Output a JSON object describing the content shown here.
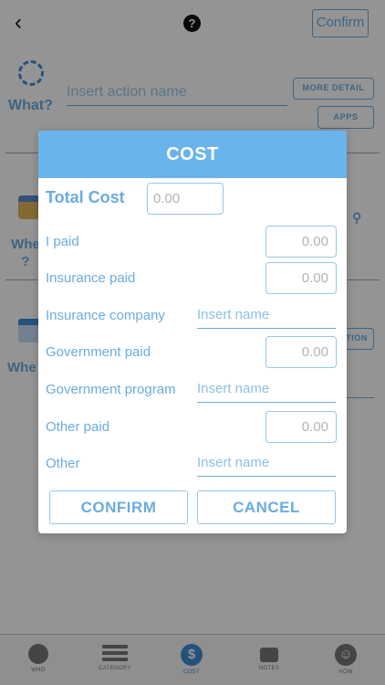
{
  "header": {
    "back_glyph": "‹",
    "help_glyph": "?",
    "confirm_label": "Confirm"
  },
  "what": {
    "label": "What?",
    "action_placeholder": "Insert action name",
    "more_detail_label": "MORE DETAIL",
    "apps_label": "APPS"
  },
  "when": {
    "label_line1": "Whe",
    "label_line2": "?"
  },
  "where": {
    "label": "Whe",
    "location_btn_fragment": "TION"
  },
  "tabbar": {
    "tabs": [
      {
        "label": "WHO",
        "icon": "person-icon"
      },
      {
        "label": "CATEGORY",
        "icon": "list-icon"
      },
      {
        "label": "COST",
        "icon": "dollar-icon",
        "selected": true
      },
      {
        "label": "NOTES",
        "icon": "notes-icon"
      },
      {
        "label": "HOW",
        "icon": "smile-icon"
      }
    ]
  },
  "cost_modal": {
    "title": "COST",
    "total_cost_label": "Total Cost",
    "total_cost_placeholder": "0.00",
    "i_paid_label": "I paid",
    "i_paid_placeholder": "0.00",
    "insurance_paid_label": "Insurance paid",
    "insurance_paid_placeholder": "0.00",
    "insurance_company_label": "Insurance company",
    "insurance_company_placeholder": "Insert name",
    "government_paid_label": "Government paid",
    "government_paid_placeholder": "0.00",
    "government_program_label": "Government program",
    "government_program_placeholder": "Insert name",
    "other_paid_label": "Other paid",
    "other_paid_placeholder": "0.00",
    "other_label": "Other",
    "other_placeholder": "Insert name",
    "confirm_label": "CONFIRM",
    "cancel_label": "CANCEL"
  },
  "colors": {
    "accent": "#6aace0",
    "header": "#6ab4ec",
    "selected_tab": "#3e8ed6"
  }
}
